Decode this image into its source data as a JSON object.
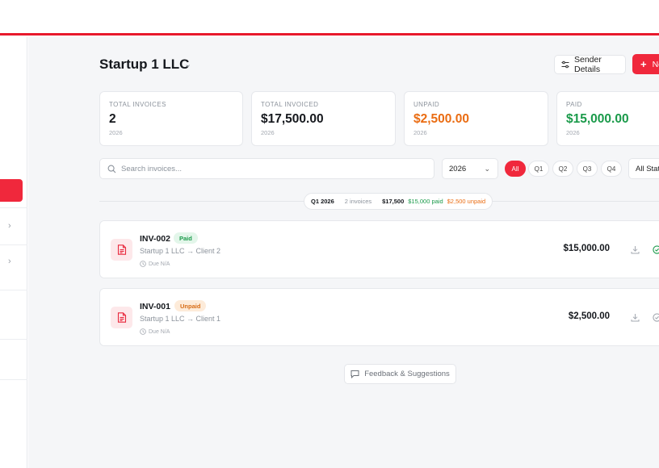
{
  "header": {
    "company_name": "Startup 1 LLC",
    "sender_details_label": "Sender Details",
    "new_invoice_label": "New Invoice"
  },
  "stats": [
    {
      "label": "TOTAL INVOICES",
      "value": "2",
      "year": "2026",
      "color": "#15181d"
    },
    {
      "label": "TOTAL INVOICED",
      "value": "$17,500.00",
      "year": "2026",
      "color": "#15181d"
    },
    {
      "label": "UNPAID",
      "value": "$2,500.00",
      "year": "2026",
      "color": "#ea6c12"
    },
    {
      "label": "PAID",
      "value": "$15,000.00",
      "year": "2026",
      "color": "#1a9a4a"
    }
  ],
  "filters": {
    "search_placeholder": "Search invoices...",
    "year_selected": "2026",
    "quarters": [
      "All",
      "Q1",
      "Q2",
      "Q3",
      "Q4"
    ],
    "active_quarter": "All",
    "status_selected": "All Status"
  },
  "quarter_summary": {
    "quarter": "Q1 2026",
    "count": "2 invoices",
    "total": "$17,500",
    "paid": "$15,000 paid",
    "unpaid": "$2,500 unpaid"
  },
  "invoices": [
    {
      "number": "INV-002",
      "status": "Paid",
      "route": "Startup 1 LLC → Client 2",
      "due": "Due N/A",
      "amount": "$15,000.00"
    },
    {
      "number": "INV-001",
      "status": "Unpaid",
      "route": "Startup 1 LLC → Client 1",
      "due": "Due N/A",
      "amount": "$2,500.00"
    }
  ],
  "feedback_label": "Feedback & Suggestions",
  "colors": {
    "accent": "#f0283c",
    "paid": "#1a9a4a",
    "unpaid": "#ea6c12"
  }
}
